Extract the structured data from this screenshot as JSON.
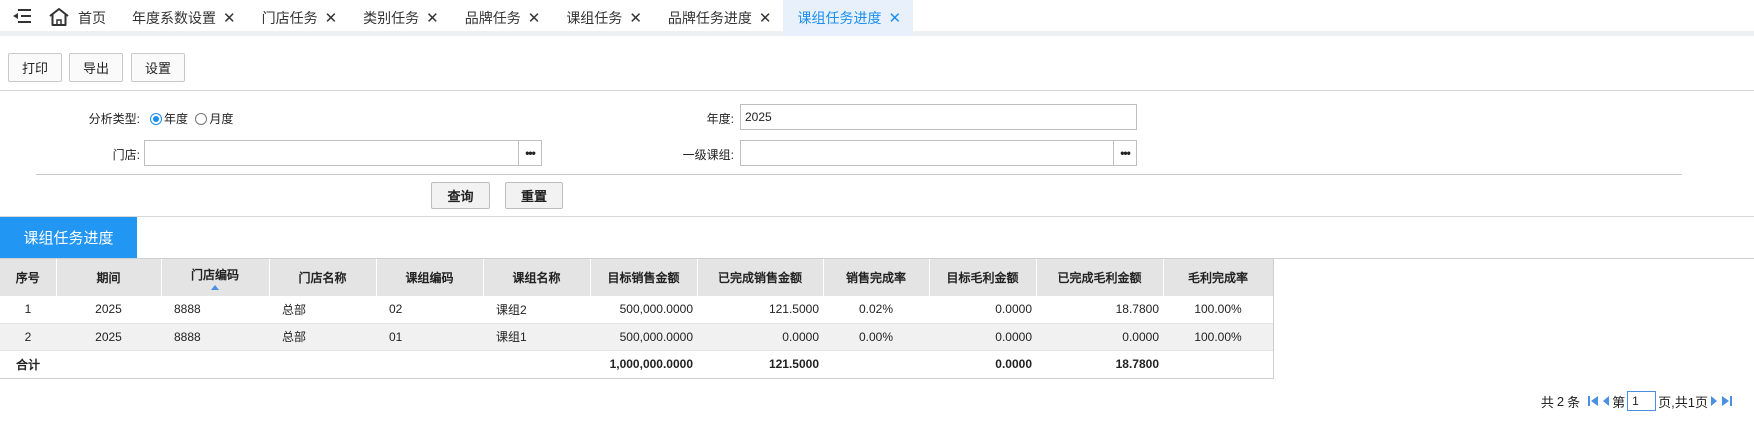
{
  "tabs": [
    {
      "label": "首页"
    },
    {
      "label": "年度系数设置"
    },
    {
      "label": "门店任务"
    },
    {
      "label": "类别任务"
    },
    {
      "label": "品牌任务"
    },
    {
      "label": "课组任务"
    },
    {
      "label": "品牌任务进度"
    },
    {
      "label": "课组任务进度"
    }
  ],
  "toolbar": {
    "print": "打印",
    "export": "导出",
    "settings": "设置"
  },
  "filters": {
    "analysis_type_label": "分析类型:",
    "option_year": "年度",
    "option_month": "月度",
    "selected": "年度",
    "year_label": "年度:",
    "year_value": "2025",
    "store_label": "门店:",
    "store_value": "",
    "group_label": "一级课组:",
    "group_value": ""
  },
  "actions": {
    "query": "查询",
    "reset": "重置"
  },
  "section_title": "课组任务进度",
  "table": {
    "headers": [
      "序号",
      "期间",
      "门店编码",
      "门店名称",
      "课组编码",
      "课组名称",
      "目标销售金额",
      "已完成销售金额",
      "销售完成率",
      "目标毛利金额",
      "已完成毛利金额",
      "毛利完成率"
    ],
    "sorted_column": "门店编码",
    "rows": [
      [
        "1",
        "2025",
        "8888",
        "总部",
        "02",
        "课组2",
        "500,000.0000",
        "121.5000",
        "0.02%",
        "0.0000",
        "18.7800",
        "100.00%"
      ],
      [
        "2",
        "2025",
        "8888",
        "总部",
        "01",
        "课组1",
        "500,000.0000",
        "0.0000",
        "0.00%",
        "0.0000",
        "0.0000",
        "100.00%"
      ]
    ],
    "total": {
      "label": "合计",
      "target_sales": "1,000,000.0000",
      "done_sales": "121.5000",
      "target_profit": "0.0000",
      "done_profit": "18.7800"
    }
  },
  "pager": {
    "total_prefix": "共",
    "total_count": "2",
    "total_suffix": "条",
    "page_prefix": "第",
    "page_value": "1",
    "page_suffix": "页,共1页"
  },
  "colors": {
    "accent": "#2196f3",
    "active_tab_bg": "#e8f1fb",
    "header_bg": "#e4e4e4"
  }
}
